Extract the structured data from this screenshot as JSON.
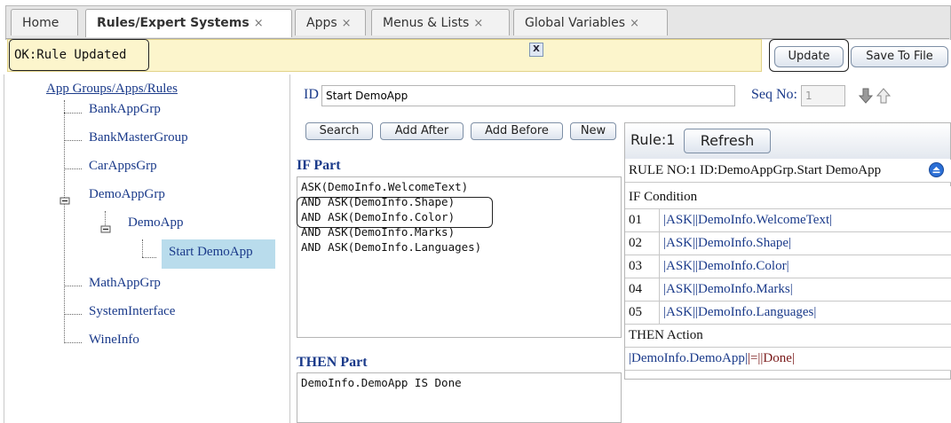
{
  "tabs": [
    {
      "label": "Home",
      "close": ""
    },
    {
      "label": "Rules/Expert Systems",
      "close": "×"
    },
    {
      "label": "Apps",
      "close": "×"
    },
    {
      "label": "Menus & Lists",
      "close": "×"
    },
    {
      "label": "Global Variables",
      "close": "×"
    }
  ],
  "status": {
    "message": "OK:Rule Updated",
    "close_label": "X"
  },
  "toolbar": {
    "update_label": "Update",
    "save_label": "Save To File"
  },
  "tree": {
    "root": "App Groups/Apps/Rules",
    "items": [
      "BankAppGrp",
      "BankMasterGroup",
      "CarAppsGrp",
      "DemoAppGrp",
      "DemoApp",
      "Start DemoApp",
      "MathAppGrp",
      "SystemInterface",
      "WineInfo"
    ]
  },
  "form": {
    "id_label": "ID",
    "id_value": "Start DemoApp",
    "seq_label": "Seq No:",
    "seq_value": "1",
    "buttons": {
      "search": "Search",
      "add_after": "Add After",
      "add_before": "Add Before",
      "new": "New"
    },
    "if_label": "IF Part",
    "if_lines": [
      "ASK(DemoInfo.WelcomeText)",
      "AND ASK(DemoInfo.Shape)",
      "AND ASK(DemoInfo.Color)",
      "AND ASK(DemoInfo.Marks)",
      "AND ASK(DemoInfo.Languages)"
    ],
    "then_label": "THEN Part",
    "then_lines": [
      "DemoInfo.DemoApp IS Done"
    ]
  },
  "rule": {
    "label": "Rule:1",
    "refresh_label": "Refresh",
    "title": "RULE NO:1 ID:DemoAppGrp.Start DemoApp",
    "if_header": "IF Condition",
    "conditions": [
      {
        "num": "01",
        "kw": "|ASK|",
        "val": "|DemoInfo.WelcomeText|"
      },
      {
        "num": "02",
        "kw": "|ASK|",
        "val": "|DemoInfo.Shape|"
      },
      {
        "num": "03",
        "kw": "|ASK|",
        "val": "|DemoInfo.Color|"
      },
      {
        "num": "04",
        "kw": "|ASK|",
        "val": "|DemoInfo.Marks|"
      },
      {
        "num": "05",
        "kw": "|ASK|",
        "val": "|DemoInfo.Languages|"
      }
    ],
    "then_header": "THEN Action",
    "then_action": {
      "a": "|DemoInfo.DemoApp|",
      "op": "|=|",
      "b": "|Done|"
    }
  },
  "colors": {
    "status_bg": "#fcf5cc",
    "link": "#1a3a8a",
    "selected": "#b9dcec",
    "keyword": "#7a1a1a"
  }
}
